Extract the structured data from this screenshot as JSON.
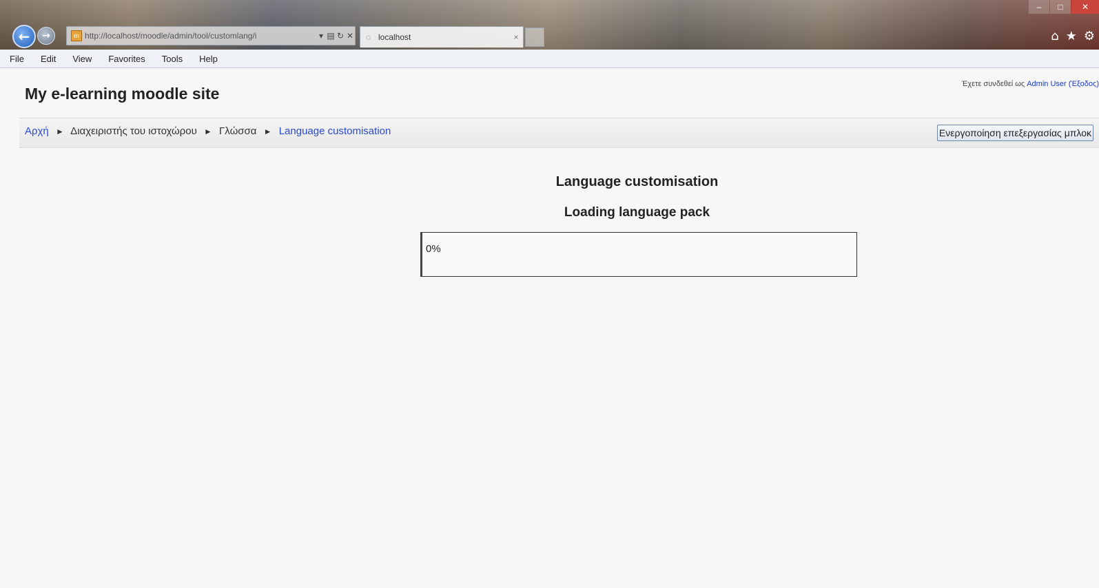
{
  "browser": {
    "url": "http://localhost/moodle/admin/tool/customlang/i",
    "tab_title": "localhost",
    "menu": [
      "File",
      "Edit",
      "View",
      "Favorites",
      "Tools",
      "Help"
    ]
  },
  "header": {
    "site_title": "My e-learning moodle site",
    "login_prefix": "Έχετε συνδεθεί ως",
    "login_user": "Admin User",
    "logout_label": "(Έξοδος)"
  },
  "breadcrumb": {
    "items": [
      "Αρχή",
      "Διαχειριστής του ιστοχώρου",
      "Γλώσσα",
      "Language customisation"
    ],
    "separator": "►"
  },
  "block_editing_button": "Ενεργοποίηση επεξεργασίας μπλοκ",
  "main": {
    "heading": "Language customisation",
    "subheading": "Loading language pack",
    "progress_text": "0%",
    "progress_fraction": 0
  },
  "colors": {
    "link": "#2a4ad0",
    "progress": "#6aa5e8"
  }
}
